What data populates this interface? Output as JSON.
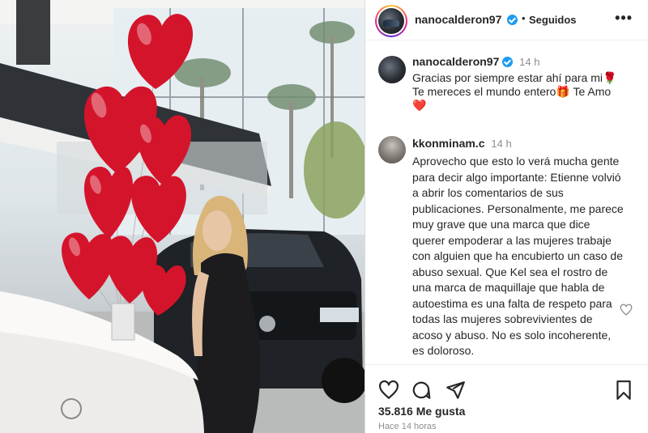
{
  "post": {
    "author": "nanocalderon97",
    "follow_state": "Seguidos",
    "separator": "•",
    "more_label": "•••",
    "likes": "35.816 Me gusta",
    "posted_ago": "Hace 14 horas"
  },
  "comments": [
    {
      "user": "nanocalderon97",
      "time": "14 h",
      "verified": true,
      "text_line1": "Gracias por siempre estar ahí para mi🌹",
      "text_line2": "Te mereces el mundo entero🎁 Te Amo",
      "text_line3": "❤️"
    },
    {
      "user": "kkonminam.c",
      "time": "14 h",
      "verified": false,
      "text": "Aprovecho que esto lo verá mucha gente para decir algo importante: Etienne volvió a abrir los comentarios de sus publicaciones. Personalmente, me parece muy grave que una marca que dice querer empoderar a las mujeres trabaje con alguien que ha encubierto un caso de abuso sexual. Que Kel sea el rostro de una marca de maquillaje que habla de autoestima es una falta de respeto para todas las mujeres sobrevivientes de acoso y abuso. No es solo incoherente, es doloroso."
    }
  ],
  "icons": {
    "like": "heart-icon",
    "comment": "comment-icon",
    "share": "share-icon",
    "save": "bookmark-icon",
    "more": "more-icon",
    "verified": "verified-badge-icon"
  },
  "colors": {
    "verified_blue": "#1d9bf0",
    "balloon_red": "#d4142b",
    "muted_text": "#8e8e8e"
  }
}
